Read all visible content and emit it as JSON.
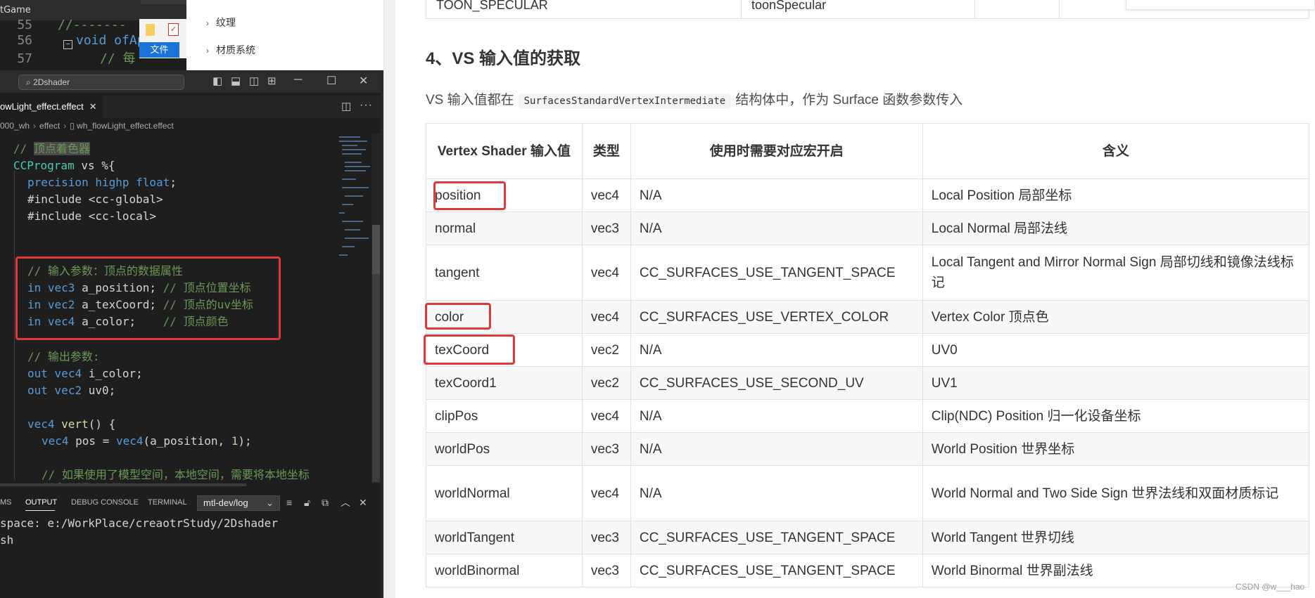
{
  "background_window": {
    "title": "tGame",
    "code_lines": [
      {
        "num": "55",
        "text": "//-------"
      },
      {
        "num": "56",
        "text": "void ofAp"
      },
      {
        "num": "57",
        "text": "// 每"
      }
    ],
    "popup": {
      "file_tab": "文件"
    }
  },
  "middle_nav": {
    "items": [
      {
        "label": "纹理"
      },
      {
        "label": "材质系统"
      }
    ]
  },
  "vscode": {
    "search": "2Dshader",
    "tab": {
      "label": "owLight_effect.effect"
    },
    "breadcrumb": [
      "000_wh",
      "effect",
      "wh_flowLight_effect.effect"
    ],
    "panel": {
      "tabs": [
        "MS",
        "OUTPUT",
        "DEBUG CONSOLE",
        "TERMINAL"
      ],
      "select": "mtl-dev/log",
      "output_lines": [
        "space: e:/WorkPlace/creaotrStudy/2Dshader",
        "sh"
      ]
    },
    "icons": [
      "layout-sidebar-icon",
      "layout-panel-icon",
      "layout-sidebar-right-icon",
      "layout-customize-icon",
      "minimize-icon",
      "maximize-icon",
      "close-icon",
      "split-editor-icon",
      "more-icon",
      "clear-output-icon",
      "lock-icon",
      "new-window-icon",
      "maximize-panel-icon",
      "close-panel-icon"
    ]
  },
  "doc": {
    "top_table": {
      "cells": [
        "TOON_SPECULAR",
        "toonSpecular",
        "",
        ""
      ]
    },
    "heading": "4、VS 输入值的获取",
    "intro": {
      "before": "VS 输入值都在",
      "code": "SurfacesStandardVertexIntermediate",
      "after": "结构体中，作为 Surface 函数参数传入"
    },
    "table": {
      "headers": [
        "Vertex Shader 输入值",
        "类型",
        "使用时需要对应宏开启",
        "含义"
      ],
      "rows": [
        [
          "position",
          "vec4",
          "N/A",
          "Local Position 局部坐标"
        ],
        [
          "normal",
          "vec3",
          "N/A",
          "Local Normal 局部法线"
        ],
        [
          "tangent",
          "vec4",
          "CC_SURFACES_USE_TANGENT_SPACE",
          "Local Tangent and Mirror Normal Sign 局部切线和镜像法线标记"
        ],
        [
          "color",
          "vec4",
          "CC_SURFACES_USE_VERTEX_COLOR",
          "Vertex Color 顶点色"
        ],
        [
          "texCoord",
          "vec2",
          "N/A",
          "UV0"
        ],
        [
          "texCoord1",
          "vec2",
          "CC_SURFACES_USE_SECOND_UV",
          "UV1"
        ],
        [
          "clipPos",
          "vec4",
          "N/A",
          "Clip(NDC) Position 归一化设备坐标"
        ],
        [
          "worldPos",
          "vec3",
          "N/A",
          "World Position 世界坐标"
        ],
        [
          "worldNormal",
          "vec4",
          "N/A",
          "World Normal and Two Side Sign 世界法线和双面材质标记"
        ],
        [
          "worldTangent",
          "vec3",
          "CC_SURFACES_USE_TANGENT_SPACE",
          "World Tangent 世界切线"
        ],
        [
          "worldBinormal",
          "vec3",
          "CC_SURFACES_USE_TANGENT_SPACE",
          "World Binormal 世界副法线"
        ]
      ]
    },
    "highlighted_rows": [
      "position",
      "color",
      "texCoord"
    ],
    "watermark": "CSDN @w___hao"
  },
  "colors": {
    "highlight_red": "#e03838",
    "editor_bg": "#1e1e1e",
    "keyword_blue": "#569cd6",
    "comment_green": "#6a9955"
  }
}
